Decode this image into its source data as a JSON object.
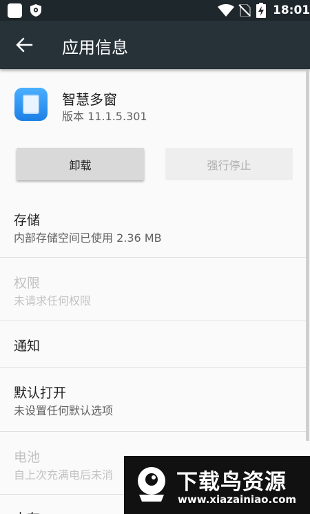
{
  "status_bar": {
    "time": "18:01"
  },
  "app_bar": {
    "title": "应用信息"
  },
  "app": {
    "name": "智慧多窗",
    "version": "版本 11.1.5.301"
  },
  "buttons": {
    "uninstall": "卸载",
    "force_stop": "强行停止"
  },
  "items": [
    {
      "title": "存储",
      "subtitle": "内部存储空间已使用 2.36 MB",
      "enabled": true
    },
    {
      "title": "权限",
      "subtitle": "未请求任何权限",
      "enabled": false
    },
    {
      "title": "通知",
      "subtitle": "",
      "enabled": true
    },
    {
      "title": "默认打开",
      "subtitle": "未设置任何默认选项",
      "enabled": true
    },
    {
      "title": "电池",
      "subtitle": "自上次充满电后未消",
      "enabled": false
    },
    {
      "title": "内存",
      "subtitle": "",
      "enabled": true
    }
  ],
  "watermark": {
    "title": "下载鸟资源",
    "url": "www.xiazainiao.com"
  }
}
